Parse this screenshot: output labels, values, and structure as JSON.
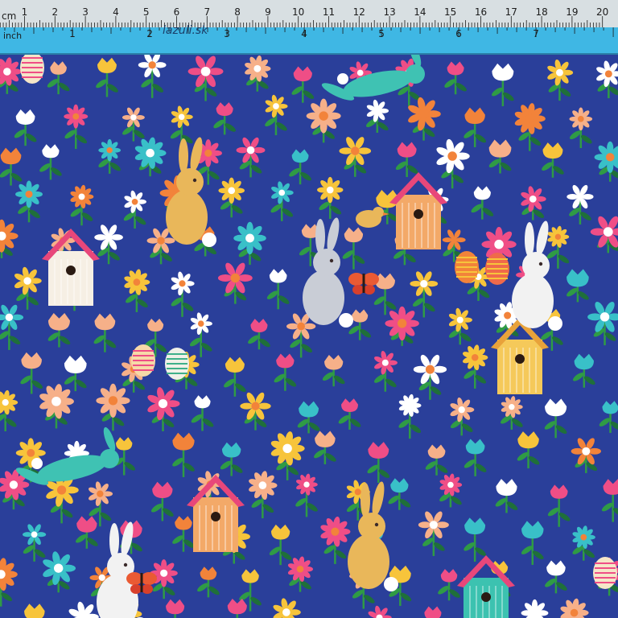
{
  "ruler": {
    "cm_unit": "cm",
    "inch_unit": "inch",
    "brand": "lazuli.sk",
    "cm_numbers": [
      "1",
      "2",
      "3",
      "4",
      "5",
      "6",
      "7",
      "8",
      "9",
      "10",
      "11",
      "12",
      "13",
      "14",
      "15",
      "16",
      "17",
      "18",
      "19",
      "20"
    ],
    "inch_numbers": [
      "1",
      "2",
      "3",
      "4",
      "5",
      "6",
      "7"
    ],
    "colors": {
      "cm_band": "#d8dfe2",
      "inch_band": "#3fb7e4",
      "ink": "#1b1b1b"
    }
  },
  "fabric": {
    "background": "#2a3f9a",
    "motifs": [
      "bunny-icon",
      "leaping-bunny-icon",
      "birdhouse-icon",
      "flower-icon",
      "tulip-icon",
      "easter-egg-icon",
      "bird-icon",
      "butterfly-icon"
    ],
    "colors": {
      "leaf": "#2f9b45",
      "leaf_dark": "#1f6f3a",
      "bunny_tan": "#e9b75a",
      "bunny_white": "#f2f2f2",
      "bunny_teal": "#3fc2b3",
      "flower_yellow": "#f7c43b",
      "flower_pink": "#ef4e86",
      "flower_orange": "#f2833a",
      "flower_teal": "#39c0c8",
      "flower_peach": "#f6b089",
      "house_orange": "#f3a968",
      "house_yellow": "#f5c95a",
      "house_teal": "#3cc2b0",
      "roof_pink": "#e8477a"
    }
  }
}
